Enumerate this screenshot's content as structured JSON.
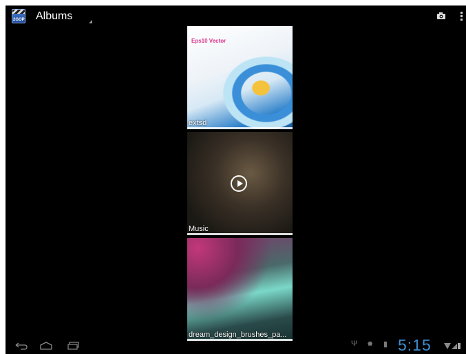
{
  "action_bar": {
    "title": "Albums",
    "icons": [
      "clapperboard-app-icon",
      "camera-icon",
      "overflow-menu-icon"
    ]
  },
  "albums": [
    {
      "label": "extsd",
      "thumb": "vector-art-banner",
      "banner_text": "Eps10 Vector",
      "has_play": false
    },
    {
      "label": "Music",
      "thumb": "dark-video-frame",
      "has_play": true
    },
    {
      "label": "dream_design_brushes_pa...",
      "thumb": "pink-green-abstract",
      "has_play": false
    }
  ],
  "nav_bar": {
    "icons": [
      "back-icon",
      "home-icon",
      "recent-apps-icon"
    ],
    "status_icons": [
      "usb-icon",
      "debug-icon",
      "sd-card-icon",
      "wifi-icon",
      "signal-icon",
      "battery-icon"
    ],
    "clock": "5:15"
  },
  "colors": {
    "clock": "#3d8ed0",
    "background": "#000000"
  }
}
